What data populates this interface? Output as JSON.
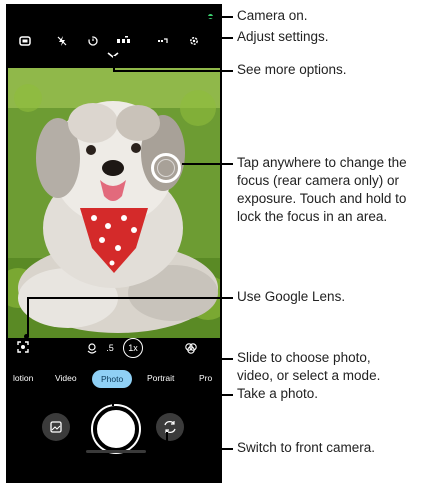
{
  "camera_ui": {
    "zoom_labels": [
      ".5",
      "1x"
    ],
    "modes": [
      "lotion",
      "Video",
      "Photo",
      "Portrait",
      "Pro"
    ],
    "active_mode": "Photo",
    "accent_color": "#8fd0f5"
  },
  "callouts": {
    "camera_on": "Camera on.",
    "adjust_settings": "Adjust settings.",
    "more_options": "See more options.",
    "focus_line1": "Tap anywhere to change the",
    "focus_line2": "focus (rear camera only) or",
    "focus_line3": "exposure. Touch and hold to",
    "focus_line4": "lock the focus in an area.",
    "lens": "Use Google Lens.",
    "slide_line1": "Slide to choose photo,",
    "slide_line2": "video, or select a mode.",
    "take_photo": "Take a photo.",
    "switch_camera": "Switch to front camera."
  }
}
